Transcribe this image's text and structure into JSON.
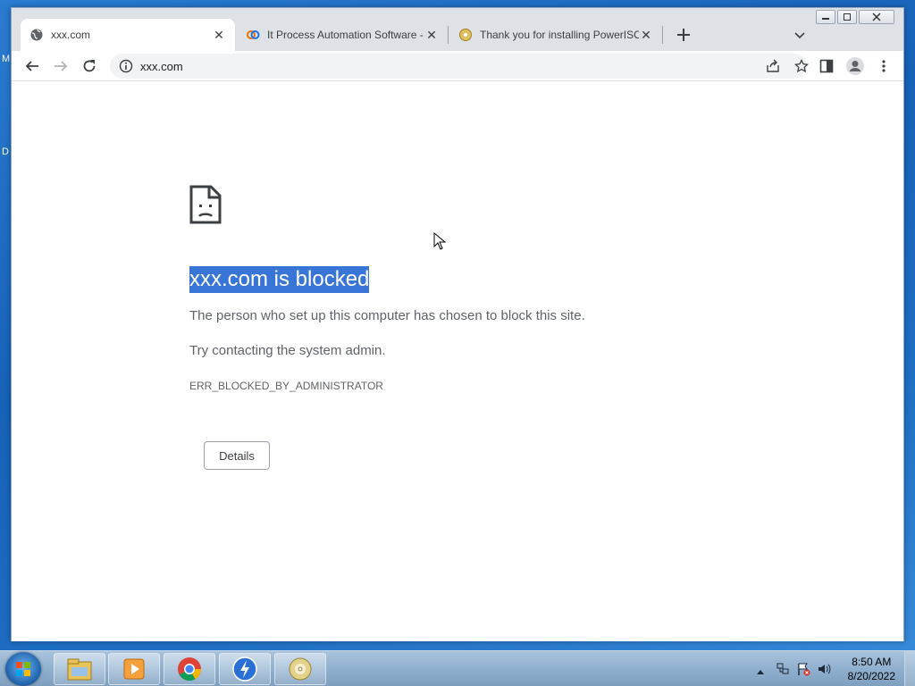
{
  "desktop": {
    "edge_text_1": "M",
    "edge_text_2": "D"
  },
  "browser": {
    "tabs": [
      {
        "title": "xxx.com",
        "active": true
      },
      {
        "title": "It Process Automation Software -",
        "active": false
      },
      {
        "title": "Thank you for installing PowerISO",
        "active": false
      }
    ],
    "address": "xxx.com"
  },
  "page": {
    "heading": "xxx.com is blocked",
    "paragraph1": "The person who set up this computer has chosen to block this site.",
    "paragraph2": "Try contacting the system admin.",
    "error_code": "ERR_BLOCKED_BY_ADMINISTRATOR",
    "details_label": "Details",
    "heading_highlight_color": "#3875d7"
  },
  "taskbar": {
    "time": "8:50 AM",
    "date": "8/20/2022",
    "pinned": [
      "file-explorer-icon",
      "media-player-icon",
      "chrome-icon",
      "thunder-app-icon",
      "disc-icon"
    ]
  }
}
